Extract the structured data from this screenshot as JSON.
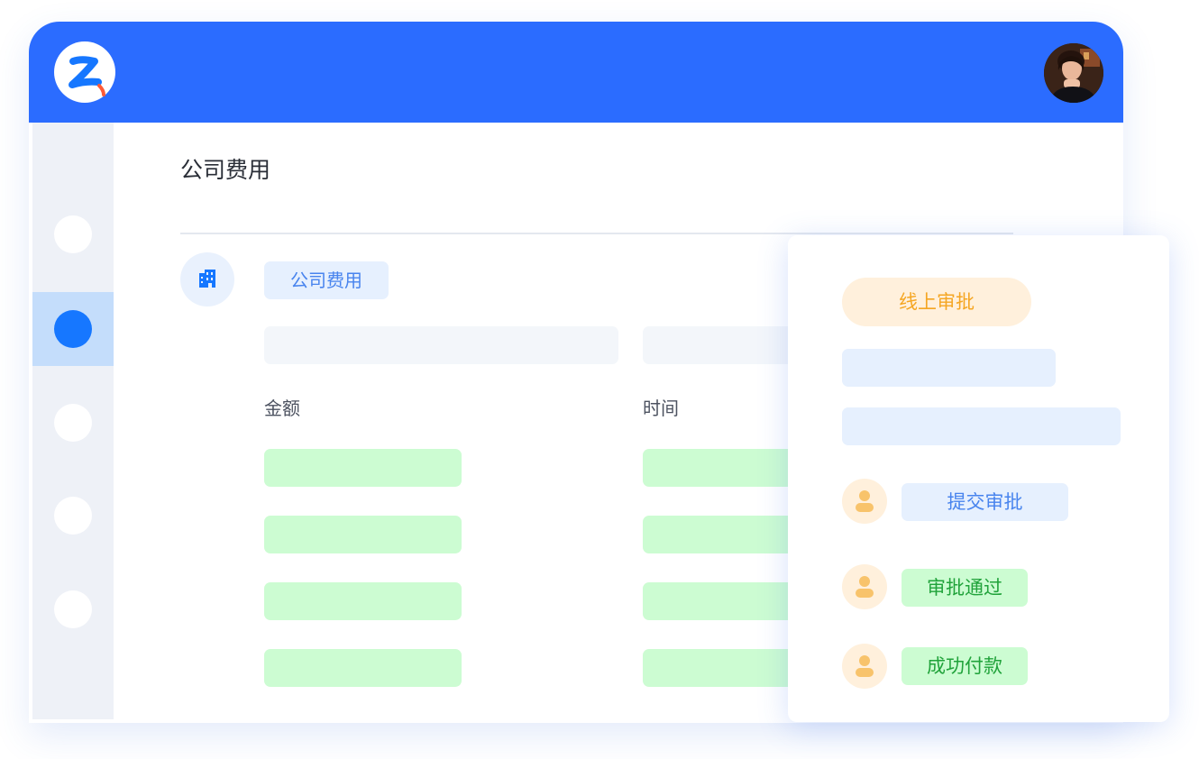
{
  "colors": {
    "header": "#2b6cff",
    "accent_blue": "#1677ff",
    "placeholder_green": "#ccfcd2",
    "badge_orange": "#f5a623"
  },
  "header": {
    "logo_icon": "z-logo-icon",
    "avatar_icon": "user-avatar"
  },
  "sidebar": {
    "items": [
      {
        "icon": "nav-dot-icon",
        "active": false
      },
      {
        "icon": "nav-dot-icon",
        "active": true
      },
      {
        "icon": "nav-dot-icon",
        "active": false
      },
      {
        "icon": "nav-dot-icon",
        "active": false
      },
      {
        "icon": "nav-dot-icon",
        "active": false
      }
    ]
  },
  "main": {
    "title": "公司费用",
    "category_icon": "building-icon",
    "category_tag": "公司费用",
    "columns": [
      "金额",
      "时间"
    ]
  },
  "approval": {
    "badge": "线上审批",
    "steps": [
      {
        "icon": "user-icon",
        "label": "提交审批",
        "status": "pending"
      },
      {
        "icon": "user-icon",
        "label": "审批通过",
        "status": "done"
      },
      {
        "icon": "user-icon",
        "label": "成功付款",
        "status": "done"
      }
    ]
  }
}
